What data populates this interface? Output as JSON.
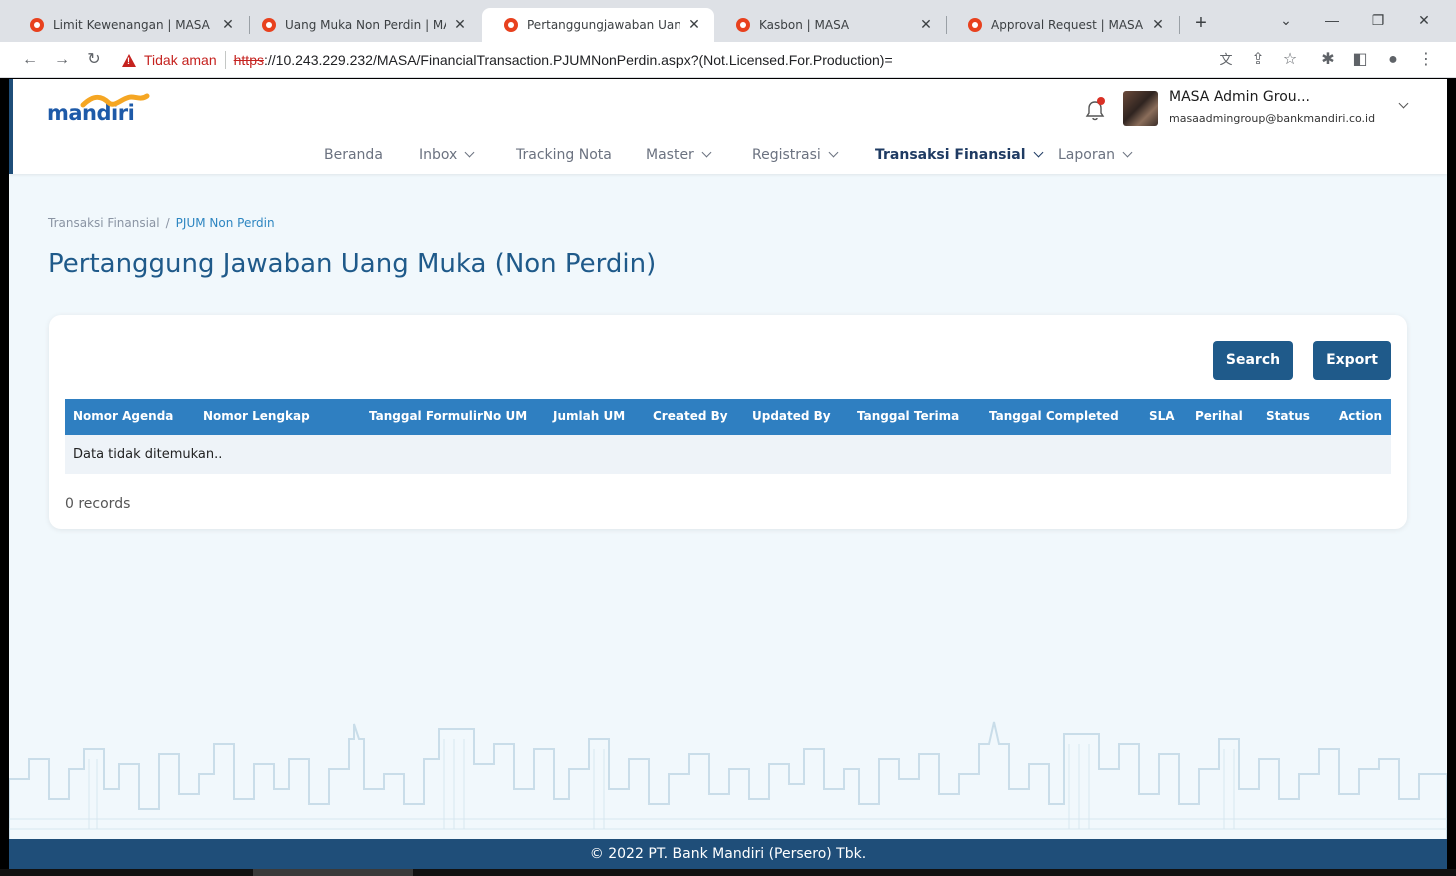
{
  "browser": {
    "tabs": [
      {
        "title": "Limit Kewenangan | MASA",
        "active": false
      },
      {
        "title": "Uang Muka Non Perdin | MASA",
        "active": false
      },
      {
        "title": "Pertanggungjawaban Uang Mu",
        "active": true
      },
      {
        "title": "Kasbon | MASA",
        "active": false
      },
      {
        "title": "Approval Request | MASA",
        "active": false
      }
    ],
    "security_label": "Tidak aman",
    "url_scheme": "https",
    "url_rest": "://10.243.229.232/MASA/FinancialTransaction.PJUMNonPerdin.aspx?(Not.Licensed.For.Production)="
  },
  "header": {
    "logo_text": "mandiri",
    "user_name": "MASA Admin Grou...",
    "user_email": "masaadmingroup@bankmandiri.co.id"
  },
  "nav": {
    "items": [
      {
        "label": "Beranda",
        "dropdown": false,
        "active": false
      },
      {
        "label": "Inbox",
        "dropdown": true,
        "active": false
      },
      {
        "label": "Tracking Nota",
        "dropdown": false,
        "active": false
      },
      {
        "label": "Master",
        "dropdown": true,
        "active": false
      },
      {
        "label": "Registrasi",
        "dropdown": true,
        "active": false
      },
      {
        "label": "Transaksi Finansial",
        "dropdown": true,
        "active": true
      },
      {
        "label": "Laporan",
        "dropdown": true,
        "active": false
      }
    ]
  },
  "breadcrumb": {
    "parent": "Transaksi Finansial",
    "separator": "/",
    "current": "PJUM Non Perdin"
  },
  "page": {
    "title": "Pertanggung Jawaban Uang Muka (Non Perdin)"
  },
  "actions": {
    "search_label": "Search",
    "export_label": "Export"
  },
  "table": {
    "columns": [
      "Nomor Agenda",
      "Nomor Lengkap",
      "Tanggal Formulir",
      "No UM",
      "Jumlah UM",
      "Created By",
      "Updated By",
      "Tanggal Terima",
      "Tanggal Completed",
      "SLA",
      "Perihal",
      "Status",
      "Action"
    ],
    "empty_message": "Data tidak ditemukan..",
    "records_label": "0 records"
  },
  "footer": {
    "copyright": "© 2022 PT. Bank Mandiri (Persero) Tbk."
  },
  "colors": {
    "brand_primary": "#1f5a8a",
    "table_header": "#2f7fc1",
    "footer_bg": "#1f4e79",
    "page_bg": "#f1f8fc",
    "notification_dot": "#d93025",
    "logo_wave": "#f5a623"
  }
}
